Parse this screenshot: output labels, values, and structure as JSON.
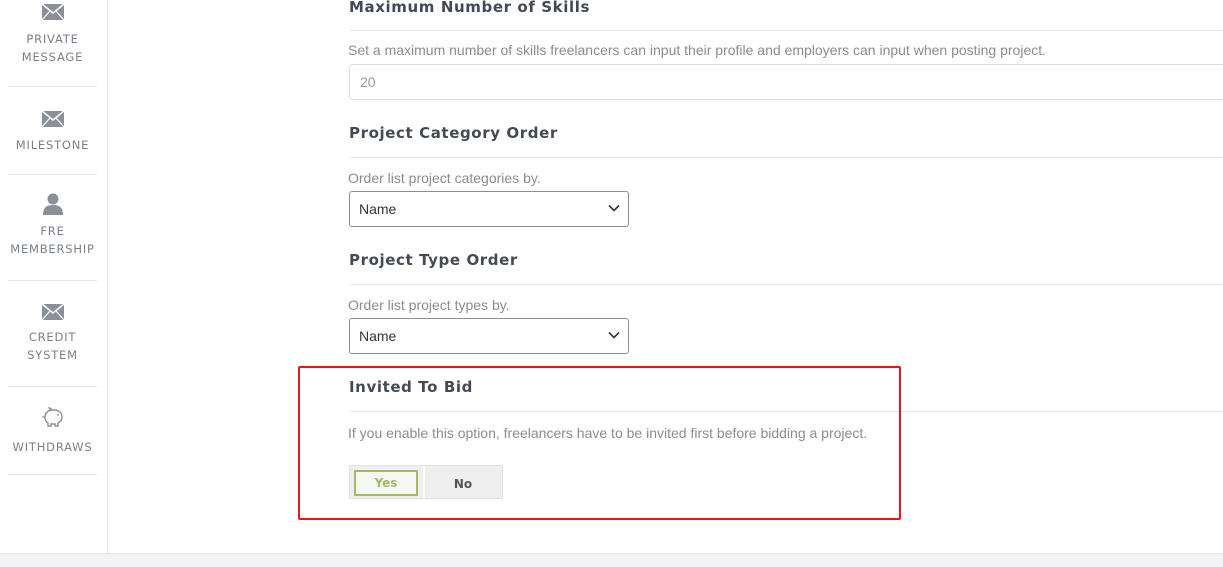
{
  "sidebar": {
    "items": [
      {
        "label_line1": "PRIVATE",
        "label_line2": "MESSAGE",
        "icon": "envelope-icon"
      },
      {
        "label_line1": "MILESTONE",
        "label_line2": "",
        "icon": "envelope-icon"
      },
      {
        "label_line1": "FRE",
        "label_line2": "MEMBERSHIP",
        "icon": "user-icon"
      },
      {
        "label_line1": "CREDIT",
        "label_line2": "SYSTEM",
        "icon": "envelope-icon"
      },
      {
        "label_line1": "WITHDRAWS",
        "label_line2": "",
        "icon": "piggy-bank-icon"
      }
    ]
  },
  "settings": {
    "max_skills": {
      "title": "Maximum Number of Skills",
      "description": "Set a maximum number of skills freelancers can input their profile and employers can input when posting project.",
      "value": "20"
    },
    "category_order": {
      "title": "Project Category Order",
      "description": "Order list project categories by.",
      "selected": "Name"
    },
    "type_order": {
      "title": "Project Type Order",
      "description": "Order list project types by.",
      "selected": "Name"
    },
    "invited_to_bid": {
      "title": "Invited To Bid",
      "description": "If you enable this option, freelancers have to be invited first before bidding a project.",
      "yes_label": "Yes",
      "no_label": "No",
      "selected": "Yes"
    }
  },
  "colors": {
    "highlight_border": "#e8161b",
    "toggle_active": "#a4b86a"
  }
}
